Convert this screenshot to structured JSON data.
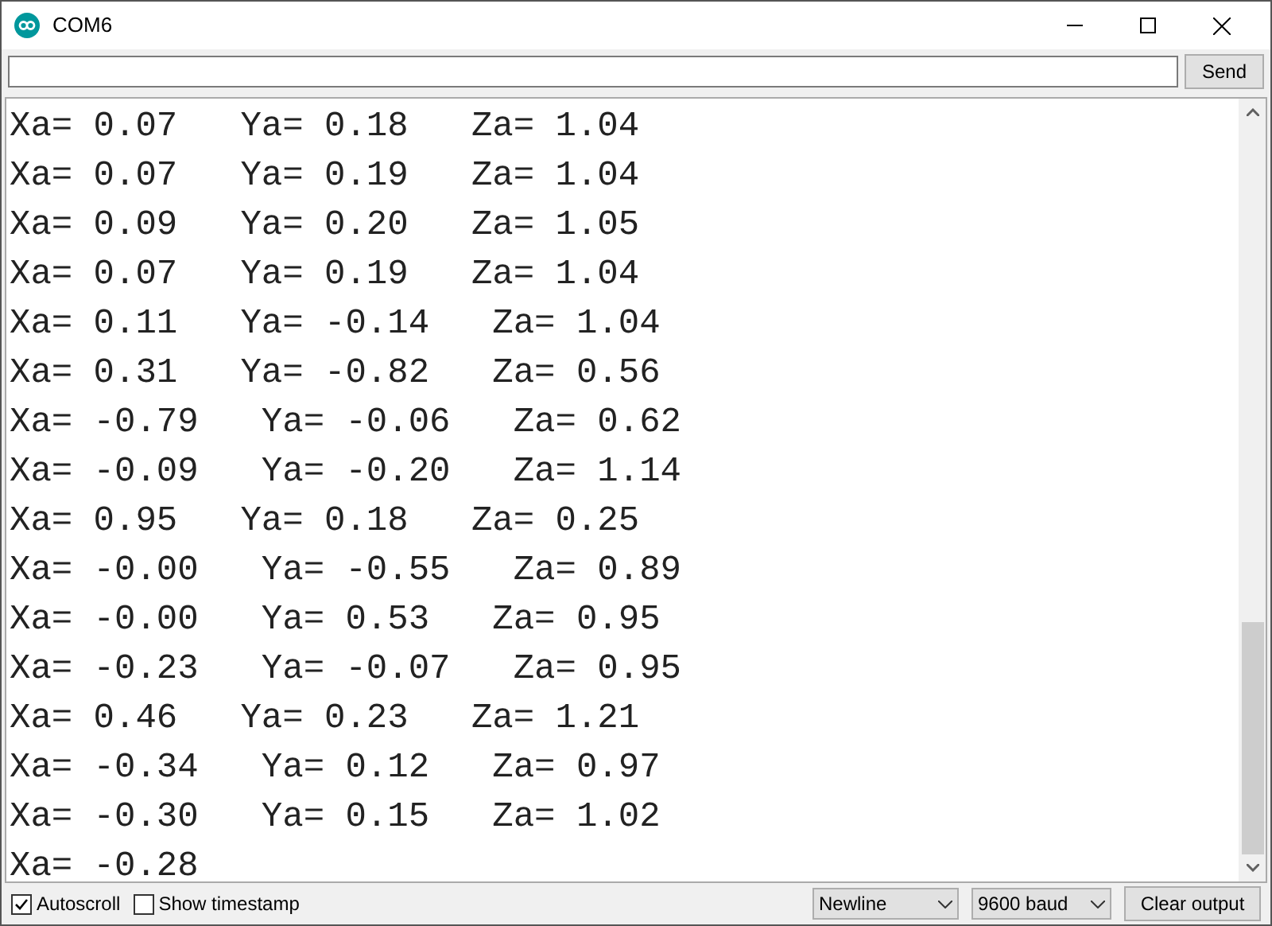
{
  "window": {
    "title": "COM6"
  },
  "input": {
    "button": "Send"
  },
  "output": {
    "lines": [
      "Xa= 0.07   Ya= 0.18   Za= 1.04",
      "Xa= 0.07   Ya= 0.19   Za= 1.04",
      "Xa= 0.09   Ya= 0.20   Za= 1.05",
      "Xa= 0.07   Ya= 0.19   Za= 1.04",
      "Xa= 0.11   Ya= -0.14   Za= 1.04",
      "Xa= 0.31   Ya= -0.82   Za= 0.56",
      "Xa= -0.79   Ya= -0.06   Za= 0.62",
      "Xa= -0.09   Ya= -0.20   Za= 1.14",
      "Xa= 0.95   Ya= 0.18   Za= 0.25",
      "Xa= -0.00   Ya= -0.55   Za= 0.89",
      "Xa= -0.00   Ya= 0.53   Za= 0.95",
      "Xa= -0.23   Ya= -0.07   Za= 0.95",
      "Xa= 0.46   Ya= 0.23   Za= 1.21",
      "Xa= -0.34   Ya= 0.12   Za= 0.97",
      "Xa= -0.30   Ya= 0.15   Za= 1.02",
      "Xa= -0.28"
    ]
  },
  "options": [
    {
      "label": "Autoscroll",
      "checked": true
    },
    {
      "label": "Show timestamp",
      "checked": false
    }
  ],
  "line_ending": "Newline",
  "baud_rate": "9600 baud",
  "clear_button": "Clear output"
}
